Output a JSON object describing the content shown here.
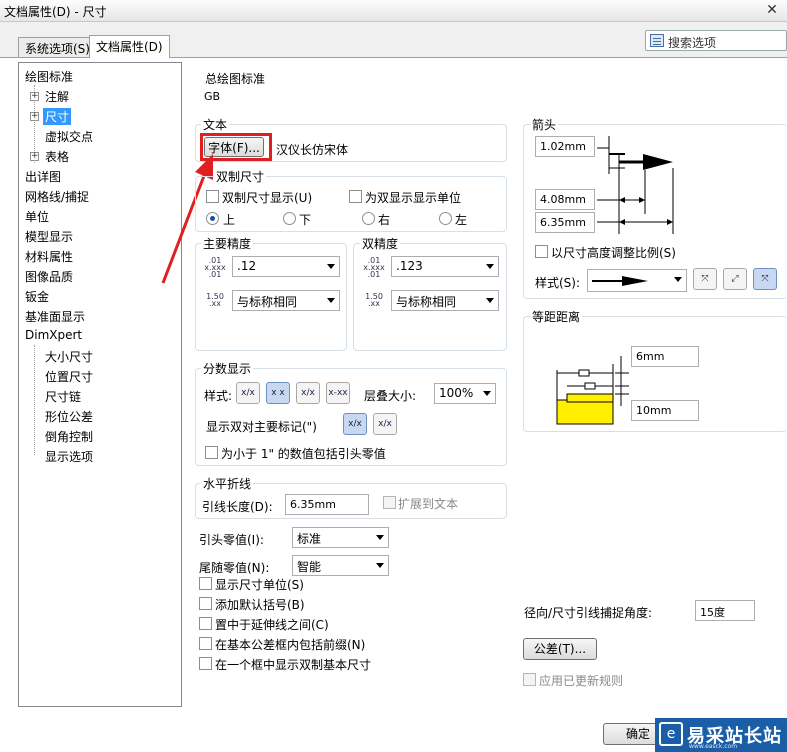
{
  "window": {
    "title": "文档属性(D) - 尺寸"
  },
  "tabs": [
    {
      "label": "系统选项(S)"
    },
    {
      "label": "文档属性(D)"
    }
  ],
  "search": {
    "label": "搜索选项"
  },
  "tree": [
    {
      "label": "绘图标准"
    },
    {
      "label": "注解"
    },
    {
      "label": "尺寸"
    },
    {
      "label": "虚拟交点"
    },
    {
      "label": "表格"
    },
    {
      "label": "出详图"
    },
    {
      "label": "网格线/捕捉"
    },
    {
      "label": "单位"
    },
    {
      "label": "模型显示"
    },
    {
      "label": "材料属性"
    },
    {
      "label": "图像品质"
    },
    {
      "label": "钣金"
    },
    {
      "label": "基准面显示"
    },
    {
      "label": "DimXpert"
    },
    {
      "label": "大小尺寸"
    },
    {
      "label": "位置尺寸"
    },
    {
      "label": "尺寸链"
    },
    {
      "label": "形位公差"
    },
    {
      "label": "倒角控制"
    },
    {
      "label": "显示选项"
    }
  ],
  "standard": {
    "label": "总绘图标准",
    "value": "GB"
  },
  "text": {
    "label": "文本",
    "font_button": "字体(F)...",
    "font_name": "汉仪长仿宋体"
  },
  "dual": {
    "label": "双制尺寸",
    "show_dual": "双制尺寸显示(U)",
    "show_units": "为双显示显示单位",
    "positions": [
      "上",
      "下",
      "右",
      "左"
    ]
  },
  "primary_precision": {
    "label": "主要精度",
    "value1": ".12",
    "value2": "与标称相同"
  },
  "dual_precision": {
    "label": "双精度",
    "value1": ".123",
    "value2": "与标称相同"
  },
  "precision_icon": {
    "top": ".01",
    "mid": "x.xxx",
    "bottom": ".01",
    "top2": "1.50",
    "bottom2": ".xx"
  },
  "fraction": {
    "label": "分数显示",
    "style_label": "样式:",
    "stack_label": "层叠大小:",
    "stack_value": "100%",
    "double_prime_label": "显示双对主要标记(\")",
    "include_zero": "为小于 1\" 的数值包括引头零值",
    "icons": [
      "x/x",
      "x x",
      "x/x",
      "x-xx"
    ]
  },
  "horizontal": {
    "label": "水平折线",
    "leader_length_label": "引线长度(D):",
    "leader_length": "6.35mm",
    "extend_to_text": "扩展到文本"
  },
  "leading_zero": {
    "label": "引头零值(I):",
    "value": "标准"
  },
  "trailing_zero": {
    "label": "尾随零值(N):",
    "value": "智能"
  },
  "checkboxes": [
    "显示尺寸单位(S)",
    "添加默认括号(B)",
    "置中于延伸线之间(C)",
    "在基本公差框内包括前缀(N)",
    "在一个框中显示双制基本尺寸"
  ],
  "arrows": {
    "label": "箭头",
    "v1": "1.02mm",
    "v2": "4.08mm",
    "v3": "6.35mm",
    "scale_label": "以尺寸高度调整比例(S)",
    "style_label": "样式(S):"
  },
  "offset": {
    "label": "等距距离",
    "v1": "6mm",
    "v2": "10mm"
  },
  "snap": {
    "label": "径向/尺寸引线捕捉角度:",
    "value": "15度"
  },
  "tolerance_button": "公差(T)...",
  "apply_rules": "应用已更新规则",
  "ok_button": "确定",
  "watermark": {
    "text": "易采站长站",
    "url": "www.easck.com"
  },
  "colors": {
    "selection": "#3399ff",
    "highlight_box": "#e02020",
    "arrow": "#e02020",
    "preview_fill": "#ffee00"
  }
}
